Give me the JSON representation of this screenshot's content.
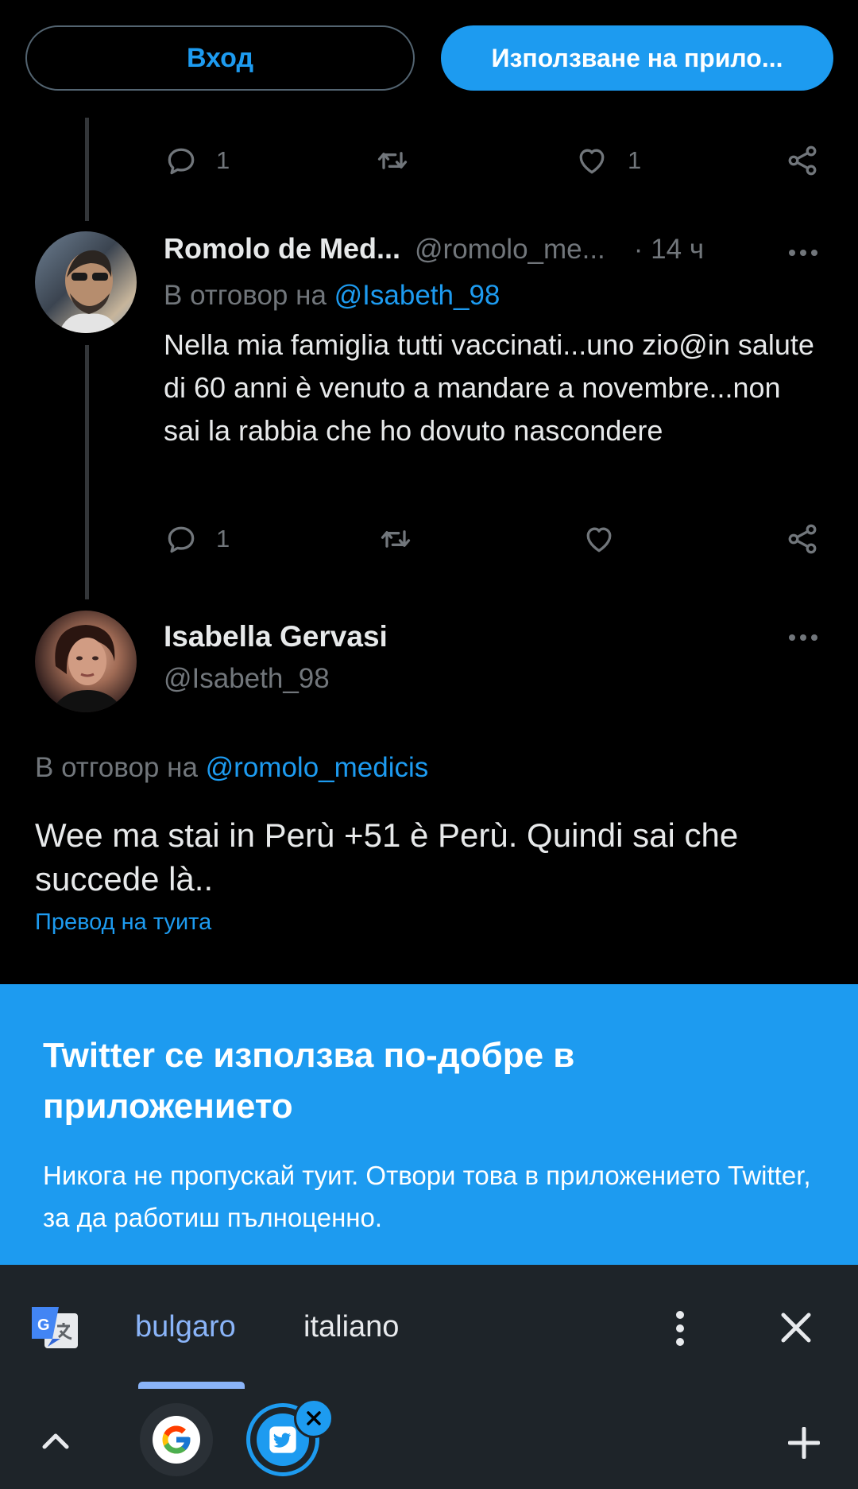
{
  "auth": {
    "login_label": "Вход",
    "use_app_label": "Използване на прило..."
  },
  "first_tweet_actions": {
    "replies": "1",
    "likes": "1"
  },
  "reply_tweet": {
    "display_name": "Romolo de Med...",
    "handle": "@romolo_me...",
    "time": "· 14 ч",
    "reply_prefix": "В отговор на",
    "reply_to": "@Isabeth_98",
    "text": "Nella mia famiglia tutti vaccinati...uno zio@in salute di 60 anni è venuto a mandare a novembre...non sai la rabbia che ho dovuto nascondere",
    "replies": "1"
  },
  "main_tweet": {
    "display_name": "Isabella Gervasi",
    "handle": "@Isabeth_98",
    "reply_prefix": "В отговор на",
    "reply_to": "@romolo_medicis",
    "text": "Wee ma stai in Perù +51 è Perù. Quindi sai che succede là..",
    "translate_label": "Превод на туита"
  },
  "banner": {
    "title": "Twitter се използва по-добре в приложението",
    "text": "Никога не пропускай туит. Отвори това в приложението Twitter, за да работиш пълноценно."
  },
  "translate_bar": {
    "lang_selected": "bulgaro",
    "lang_other": "italiano"
  },
  "colors": {
    "accent": "#1d9bf0",
    "muted": "#71767b",
    "bar": "#1e2429"
  },
  "icons": [
    "reply-icon",
    "retweet-icon",
    "like-icon",
    "share-icon",
    "more-icon",
    "translate-icon",
    "close-icon",
    "chevron-up-icon",
    "google-icon",
    "twitter-icon",
    "plus-icon"
  ]
}
